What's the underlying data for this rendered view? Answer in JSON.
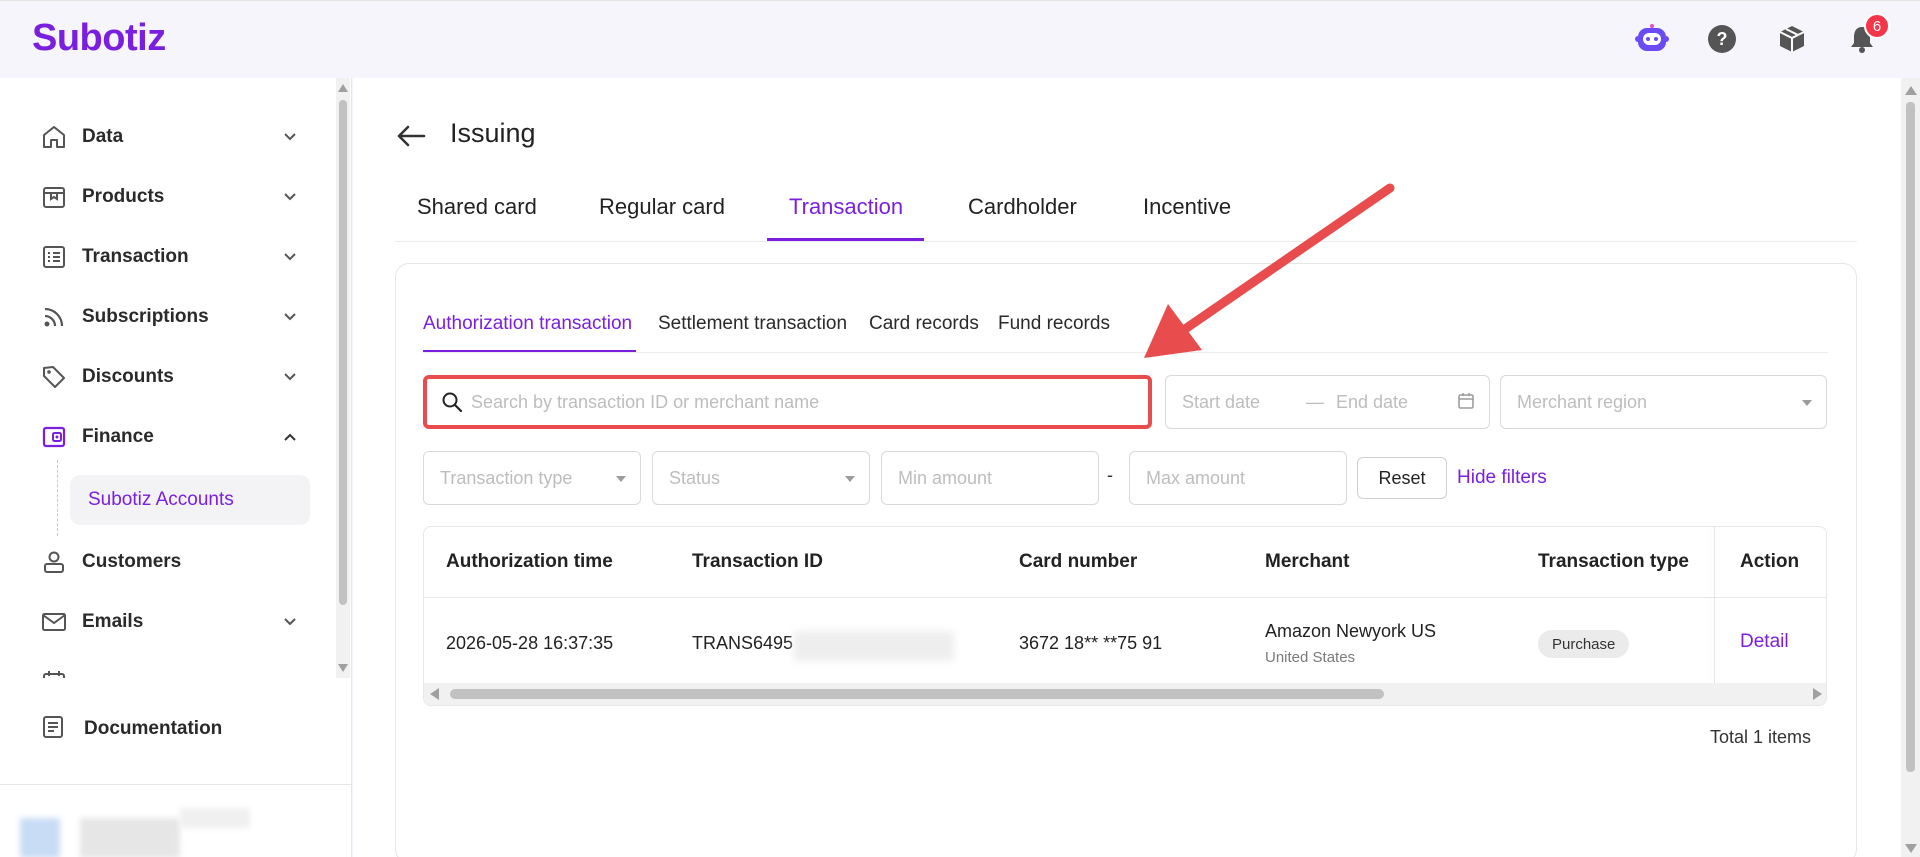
{
  "app": {
    "logo": "Subotiz"
  },
  "topbar": {
    "notification_count": "6"
  },
  "sidebar": {
    "items": [
      {
        "label": "Data",
        "icon": "home-icon"
      },
      {
        "label": "Products",
        "icon": "box-icon"
      },
      {
        "label": "Transaction",
        "icon": "list-icon"
      },
      {
        "label": "Subscriptions",
        "icon": "rss-icon"
      },
      {
        "label": "Discounts",
        "icon": "tag-icon"
      },
      {
        "label": "Finance",
        "icon": "wallet-icon"
      },
      {
        "label": "Customers",
        "icon": "user-icon"
      },
      {
        "label": "Emails",
        "icon": "mail-icon"
      }
    ],
    "sub_item": "Subotiz Accounts",
    "documentation": "Documentation"
  },
  "page": {
    "title": "Issuing",
    "tabs": [
      "Shared card",
      "Regular card",
      "Transaction",
      "Cardholder",
      "Incentive"
    ],
    "active_tab": "Transaction",
    "subtabs": [
      "Authorization transaction",
      "Settlement transaction",
      "Card records",
      "Fund records"
    ],
    "active_subtab": "Authorization transaction"
  },
  "filters": {
    "search_placeholder": "Search by transaction ID or merchant name",
    "start_date": "Start date",
    "date_sep": "—",
    "end_date": "End date",
    "merchant_region": "Merchant region",
    "transaction_type": "Transaction type",
    "status": "Status",
    "min_amount": "Min amount",
    "amount_sep": "-",
    "max_amount": "Max amount",
    "reset": "Reset",
    "hide_filters": "Hide filters"
  },
  "table": {
    "headers": [
      "Authorization time",
      "Transaction ID",
      "Card number",
      "Merchant",
      "Transaction type",
      "Action"
    ],
    "rows": [
      {
        "time": "2026-05-28 16:37:35",
        "transaction_id": "TRANS6495",
        "card_number": "3672 18** **75 91",
        "merchant": "Amazon Newyork US",
        "merchant_region": "United States",
        "transaction_type": "Purchase",
        "action": "Detail"
      }
    ],
    "total": "Total 1 items"
  },
  "colors": {
    "accent": "#7a1fe0",
    "highlight": "#e84c4c",
    "badge": "#f5364a"
  }
}
